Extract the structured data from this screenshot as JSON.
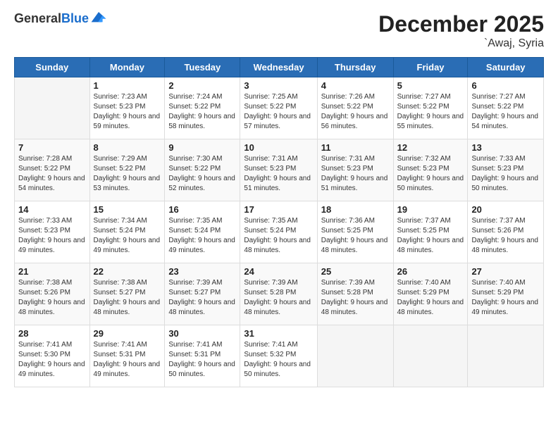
{
  "header": {
    "logo_general": "General",
    "logo_blue": "Blue",
    "title": "December 2025",
    "subtitle": "`Awaj, Syria"
  },
  "weekdays": [
    "Sunday",
    "Monday",
    "Tuesday",
    "Wednesday",
    "Thursday",
    "Friday",
    "Saturday"
  ],
  "weeks": [
    [
      {
        "day": "",
        "sunrise": "",
        "sunset": "",
        "daylight": ""
      },
      {
        "day": "1",
        "sunrise": "Sunrise: 7:23 AM",
        "sunset": "Sunset: 5:23 PM",
        "daylight": "Daylight: 9 hours and 59 minutes."
      },
      {
        "day": "2",
        "sunrise": "Sunrise: 7:24 AM",
        "sunset": "Sunset: 5:22 PM",
        "daylight": "Daylight: 9 hours and 58 minutes."
      },
      {
        "day": "3",
        "sunrise": "Sunrise: 7:25 AM",
        "sunset": "Sunset: 5:22 PM",
        "daylight": "Daylight: 9 hours and 57 minutes."
      },
      {
        "day": "4",
        "sunrise": "Sunrise: 7:26 AM",
        "sunset": "Sunset: 5:22 PM",
        "daylight": "Daylight: 9 hours and 56 minutes."
      },
      {
        "day": "5",
        "sunrise": "Sunrise: 7:27 AM",
        "sunset": "Sunset: 5:22 PM",
        "daylight": "Daylight: 9 hours and 55 minutes."
      },
      {
        "day": "6",
        "sunrise": "Sunrise: 7:27 AM",
        "sunset": "Sunset: 5:22 PM",
        "daylight": "Daylight: 9 hours and 54 minutes."
      }
    ],
    [
      {
        "day": "7",
        "sunrise": "Sunrise: 7:28 AM",
        "sunset": "Sunset: 5:22 PM",
        "daylight": "Daylight: 9 hours and 54 minutes."
      },
      {
        "day": "8",
        "sunrise": "Sunrise: 7:29 AM",
        "sunset": "Sunset: 5:22 PM",
        "daylight": "Daylight: 9 hours and 53 minutes."
      },
      {
        "day": "9",
        "sunrise": "Sunrise: 7:30 AM",
        "sunset": "Sunset: 5:22 PM",
        "daylight": "Daylight: 9 hours and 52 minutes."
      },
      {
        "day": "10",
        "sunrise": "Sunrise: 7:31 AM",
        "sunset": "Sunset: 5:23 PM",
        "daylight": "Daylight: 9 hours and 51 minutes."
      },
      {
        "day": "11",
        "sunrise": "Sunrise: 7:31 AM",
        "sunset": "Sunset: 5:23 PM",
        "daylight": "Daylight: 9 hours and 51 minutes."
      },
      {
        "day": "12",
        "sunrise": "Sunrise: 7:32 AM",
        "sunset": "Sunset: 5:23 PM",
        "daylight": "Daylight: 9 hours and 50 minutes."
      },
      {
        "day": "13",
        "sunrise": "Sunrise: 7:33 AM",
        "sunset": "Sunset: 5:23 PM",
        "daylight": "Daylight: 9 hours and 50 minutes."
      }
    ],
    [
      {
        "day": "14",
        "sunrise": "Sunrise: 7:33 AM",
        "sunset": "Sunset: 5:23 PM",
        "daylight": "Daylight: 9 hours and 49 minutes."
      },
      {
        "day": "15",
        "sunrise": "Sunrise: 7:34 AM",
        "sunset": "Sunset: 5:24 PM",
        "daylight": "Daylight: 9 hours and 49 minutes."
      },
      {
        "day": "16",
        "sunrise": "Sunrise: 7:35 AM",
        "sunset": "Sunset: 5:24 PM",
        "daylight": "Daylight: 9 hours and 49 minutes."
      },
      {
        "day": "17",
        "sunrise": "Sunrise: 7:35 AM",
        "sunset": "Sunset: 5:24 PM",
        "daylight": "Daylight: 9 hours and 48 minutes."
      },
      {
        "day": "18",
        "sunrise": "Sunrise: 7:36 AM",
        "sunset": "Sunset: 5:25 PM",
        "daylight": "Daylight: 9 hours and 48 minutes."
      },
      {
        "day": "19",
        "sunrise": "Sunrise: 7:37 AM",
        "sunset": "Sunset: 5:25 PM",
        "daylight": "Daylight: 9 hours and 48 minutes."
      },
      {
        "day": "20",
        "sunrise": "Sunrise: 7:37 AM",
        "sunset": "Sunset: 5:26 PM",
        "daylight": "Daylight: 9 hours and 48 minutes."
      }
    ],
    [
      {
        "day": "21",
        "sunrise": "Sunrise: 7:38 AM",
        "sunset": "Sunset: 5:26 PM",
        "daylight": "Daylight: 9 hours and 48 minutes."
      },
      {
        "day": "22",
        "sunrise": "Sunrise: 7:38 AM",
        "sunset": "Sunset: 5:27 PM",
        "daylight": "Daylight: 9 hours and 48 minutes."
      },
      {
        "day": "23",
        "sunrise": "Sunrise: 7:39 AM",
        "sunset": "Sunset: 5:27 PM",
        "daylight": "Daylight: 9 hours and 48 minutes."
      },
      {
        "day": "24",
        "sunrise": "Sunrise: 7:39 AM",
        "sunset": "Sunset: 5:28 PM",
        "daylight": "Daylight: 9 hours and 48 minutes."
      },
      {
        "day": "25",
        "sunrise": "Sunrise: 7:39 AM",
        "sunset": "Sunset: 5:28 PM",
        "daylight": "Daylight: 9 hours and 48 minutes."
      },
      {
        "day": "26",
        "sunrise": "Sunrise: 7:40 AM",
        "sunset": "Sunset: 5:29 PM",
        "daylight": "Daylight: 9 hours and 48 minutes."
      },
      {
        "day": "27",
        "sunrise": "Sunrise: 7:40 AM",
        "sunset": "Sunset: 5:29 PM",
        "daylight": "Daylight: 9 hours and 49 minutes."
      }
    ],
    [
      {
        "day": "28",
        "sunrise": "Sunrise: 7:41 AM",
        "sunset": "Sunset: 5:30 PM",
        "daylight": "Daylight: 9 hours and 49 minutes."
      },
      {
        "day": "29",
        "sunrise": "Sunrise: 7:41 AM",
        "sunset": "Sunset: 5:31 PM",
        "daylight": "Daylight: 9 hours and 49 minutes."
      },
      {
        "day": "30",
        "sunrise": "Sunrise: 7:41 AM",
        "sunset": "Sunset: 5:31 PM",
        "daylight": "Daylight: 9 hours and 50 minutes."
      },
      {
        "day": "31",
        "sunrise": "Sunrise: 7:41 AM",
        "sunset": "Sunset: 5:32 PM",
        "daylight": "Daylight: 9 hours and 50 minutes."
      },
      {
        "day": "",
        "sunrise": "",
        "sunset": "",
        "daylight": ""
      },
      {
        "day": "",
        "sunrise": "",
        "sunset": "",
        "daylight": ""
      },
      {
        "day": "",
        "sunrise": "",
        "sunset": "",
        "daylight": ""
      }
    ]
  ]
}
